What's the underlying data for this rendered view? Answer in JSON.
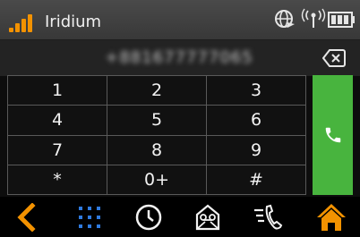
{
  "status_bar": {
    "network_name": "Iridium",
    "icons": [
      "signal-bars-icon",
      "globe-icon",
      "antenna-icon",
      "battery-icon"
    ]
  },
  "dialer": {
    "number": "+881677777065",
    "keys": [
      "1",
      "2",
      "3",
      "4",
      "5",
      "6",
      "7",
      "8",
      "9",
      "*",
      "0+",
      "#"
    ],
    "call_icon": "phone-icon",
    "backspace_icon": "backspace-icon"
  },
  "bottom_nav": {
    "items": [
      "back-chevron-icon",
      "keypad-icon",
      "clock-icon",
      "voicemail-icon",
      "call-log-icon",
      "home-icon"
    ]
  },
  "colors": {
    "accent": "#f39200",
    "call_green": "#48b43e",
    "nav_blue": "#2f7be0"
  }
}
